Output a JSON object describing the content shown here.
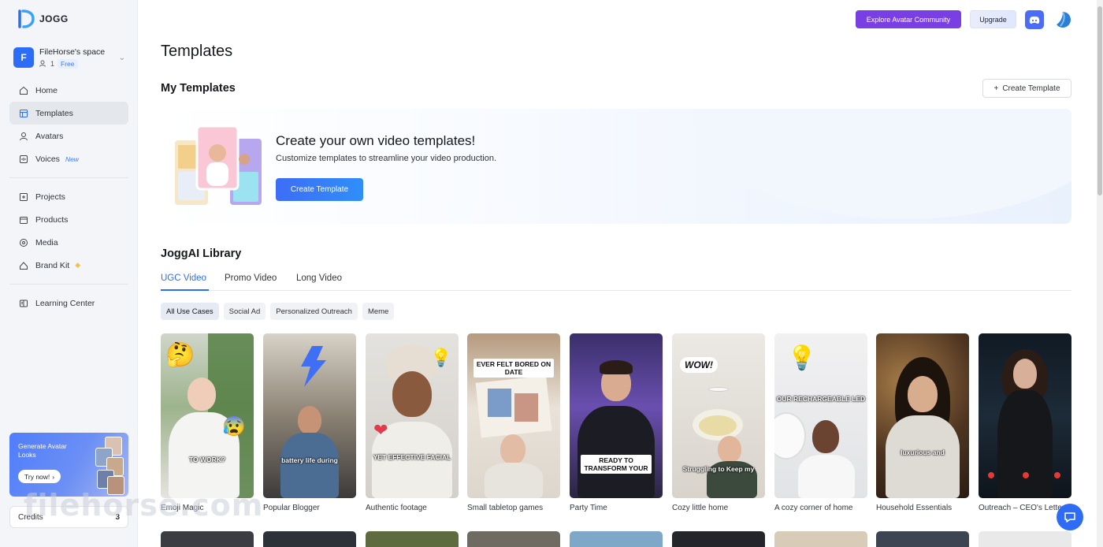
{
  "app": {
    "logo_text": "JOGG"
  },
  "workspace": {
    "avatar_letter": "F",
    "name": "FileHorse's space",
    "members": "1",
    "plan": "Free"
  },
  "nav": {
    "home": "Home",
    "templates": "Templates",
    "avatars": "Avatars",
    "voices": "Voices",
    "voices_badge": "New",
    "projects": "Projects",
    "products": "Products",
    "media": "Media",
    "brand_kit": "Brand Kit",
    "learning_center": "Learning Center"
  },
  "promo": {
    "title": "Generate Avatar Looks",
    "button": "Try now!"
  },
  "credits": {
    "label": "Credits",
    "value": "3"
  },
  "topbar": {
    "community": "Explore Avatar Community",
    "upgrade": "Upgrade"
  },
  "page": {
    "title": "Templates"
  },
  "my_templates": {
    "title": "My Templates",
    "create_button": "Create Template",
    "banner_heading": "Create your own video templates!",
    "banner_sub": "Customize templates to streamline your video production.",
    "banner_button": "Create Template"
  },
  "library": {
    "title": "JoggAI Library",
    "tabs": [
      "UGC Video",
      "Promo Video",
      "Long Video"
    ],
    "active_tab": "UGC Video",
    "chips": [
      "All Use Cases",
      "Social Ad",
      "Personalized Outreach",
      "Meme"
    ],
    "active_chip": "All Use Cases",
    "cards": [
      {
        "title": "Emoji Magic",
        "caption": "TO WORK?"
      },
      {
        "title": "Popular Blogger",
        "caption": "battery life during"
      },
      {
        "title": "Authentic footage",
        "caption": "YET EFFECTIVE FACIAL"
      },
      {
        "title": "Small tabletop games",
        "caption": "EVER FELT BORED ON DATE"
      },
      {
        "title": "Party Time",
        "caption": "READY TO TRANSFORM YOUR"
      },
      {
        "title": "Cozy little home",
        "caption": "Struggling to Keep my"
      },
      {
        "title": "A cozy corner of home",
        "caption": "OUR RECHARGEABLE LED"
      },
      {
        "title": "Household Essentials",
        "caption": "luxurious and"
      },
      {
        "title": "Outreach – CEO's Letter",
        "caption": ""
      }
    ]
  },
  "watermark": "filehorse.com",
  "colors": {
    "primary": "#2d6cf6",
    "community": "#7a3fe4",
    "sidebar_bg": "#f3f5f8"
  }
}
